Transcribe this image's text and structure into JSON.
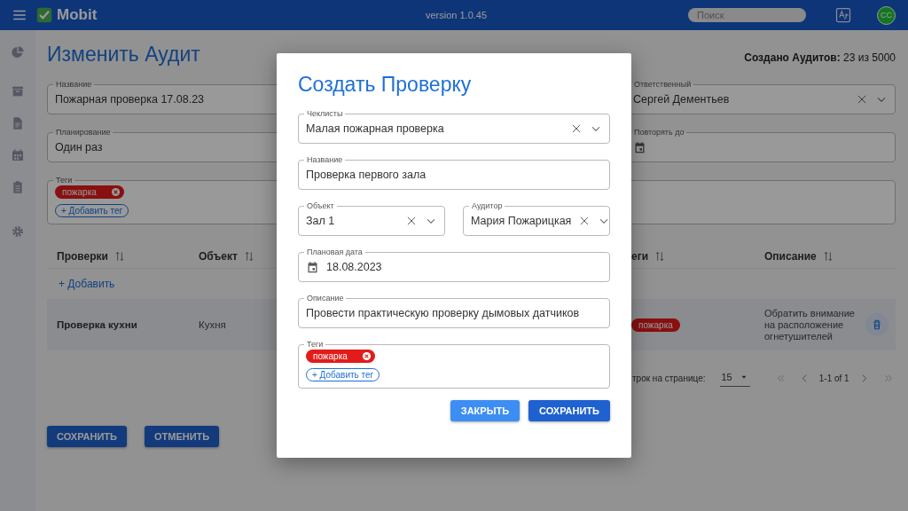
{
  "topbar": {
    "app_name": "Mobit",
    "version": "version 1.0.45",
    "search": {
      "placeholder": "Поиск"
    },
    "avatar": "CC"
  },
  "page": {
    "title": "Изменить Аудит",
    "counter": "**Создано Аудитов:** 23 из 5000",
    "fields": [
      {
        "kind": "text",
        "label": "Название",
        "value": "Пожарная проверка 17.08.23"
      },
      {
        "kind": "select",
        "label": "Ответственный",
        "value": "Сергей Дементьев"
      },
      {
        "kind": "text",
        "label": "Планирование",
        "value": "Один раз"
      },
      {
        "kind": "date",
        "label": "Повторять до"
      }
    ],
    "tags_field": {
      "label": "Теги",
      "tags": [
        "пожарка"
      ],
      "add_button": "+ Добавить тег"
    },
    "table": {
      "columns": [
        "Проверки",
        "Объект",
        "еги",
        "Описание"
      ],
      "add_link": "+ Добавить",
      "rows": [
        {
          "check": "Проверка кухни",
          "object": "Кухня",
          "tags": [
            "пожарка"
          ],
          "description": "Обратить внимание на расположение огнетушителей"
        }
      ]
    },
    "pagination": {
      "rows_label": "трок на странице:",
      "page_size": "15",
      "range": "1-1 of 1"
    },
    "buttons": [
      "СОХРАНИТЬ",
      "ОТМЕНИТЬ"
    ]
  },
  "dialog": {
    "title": "Создать Проверку",
    "rows": [
      [
        {
          "kind": "select",
          "label": "Чеклисты",
          "value": "Малая пожарная проверка"
        }
      ],
      [
        {
          "kind": "text",
          "label": "Название",
          "value": "Проверка первого зала"
        }
      ],
      [
        {
          "kind": "select",
          "label": "Объект",
          "value": "Зал 1"
        },
        {
          "kind": "select",
          "label": "Аудитор",
          "value": "Мария Пожарицкая"
        }
      ],
      [
        {
          "kind": "date",
          "label": "Плановая дата",
          "value": "18.08.2023"
        }
      ],
      [
        {
          "kind": "text",
          "label": "Описание",
          "value": "Провести практическую проверку дымовых датчиков"
        }
      ],
      [
        {
          "kind": "tags",
          "label": "Теги",
          "tags": [
            "пожарка"
          ],
          "add_button": "+ Добавить тег"
        }
      ]
    ],
    "buttons": [
      {
        "kind": "secondary",
        "label": "ЗАКРЫТЬ"
      },
      {
        "kind": "primary",
        "label": "СОХРАНИТЬ"
      }
    ]
  }
}
